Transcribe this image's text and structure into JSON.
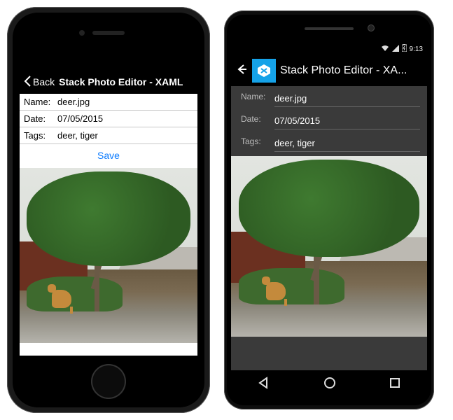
{
  "ios": {
    "back_label": "Back",
    "title": "Stack Photo Editor - XAML",
    "form": {
      "name_label": "Name:",
      "name_value": "deer.jpg",
      "date_label": "Date:",
      "date_value": "07/05/2015",
      "tags_label": "Tags:",
      "tags_value": "deer, tiger",
      "save_label": "Save"
    }
  },
  "android": {
    "status_time": "9:13",
    "title": "Stack Photo Editor - XA...",
    "form": {
      "name_label": "Name:",
      "name_value": "deer.jpg",
      "date_label": "Date:",
      "date_value": "07/05/2015",
      "tags_label": "Tags:",
      "tags_value": "deer, tiger"
    }
  }
}
